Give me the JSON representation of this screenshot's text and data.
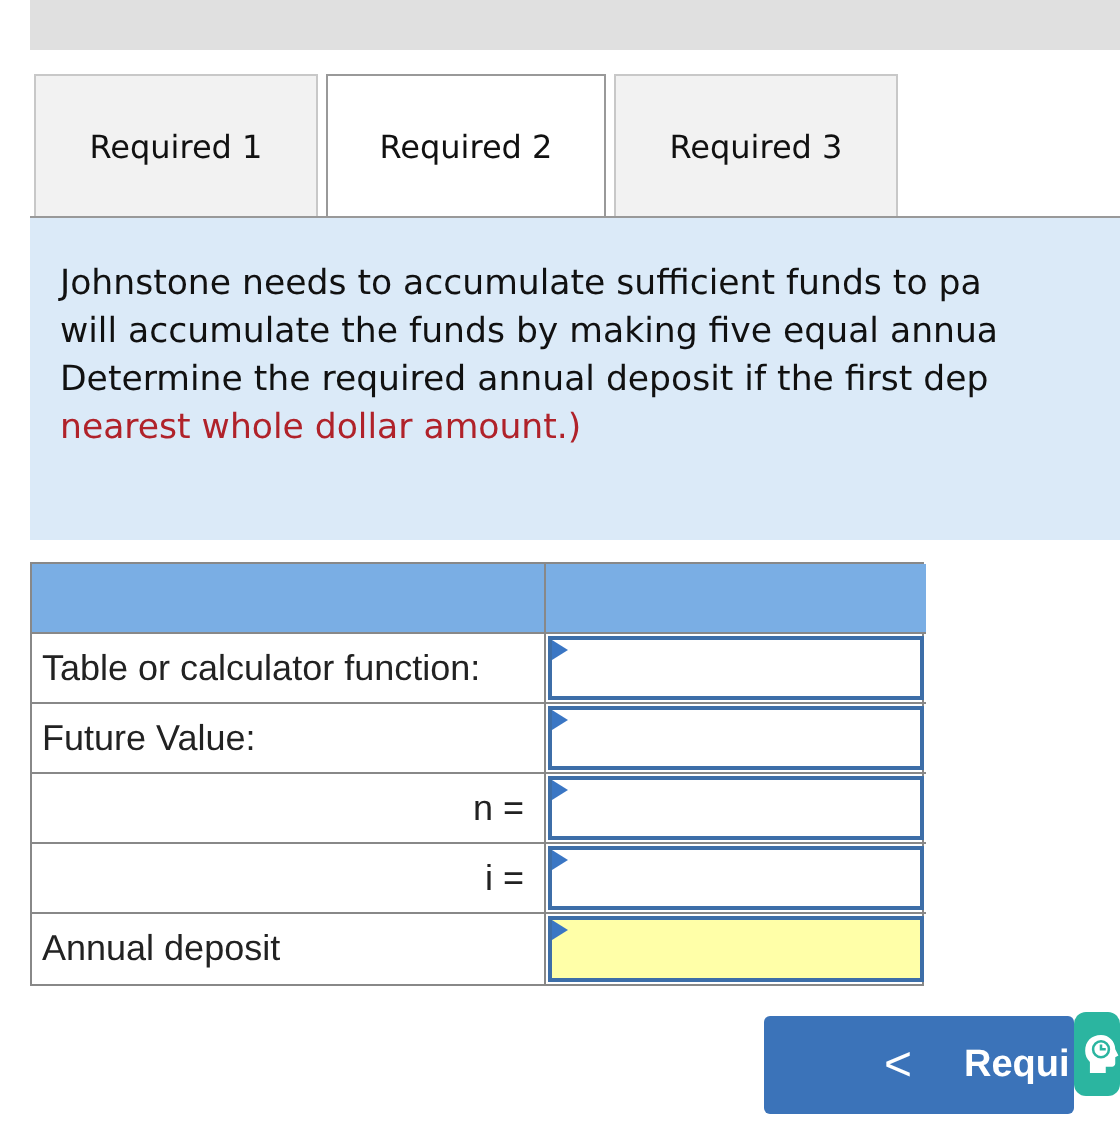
{
  "tabs": [
    {
      "label": "Required 1",
      "selected": false
    },
    {
      "label": "Required 2",
      "selected": true
    },
    {
      "label": "Required 3",
      "selected": false
    }
  ],
  "question": {
    "lines": [
      {
        "text": "Johnstone needs to accumulate sufficient funds to pa",
        "kind": "plain"
      },
      {
        "text": "will accumulate the funds by making five equal annua",
        "kind": "plain"
      },
      {
        "text": "Determine the required annual deposit if the first dep",
        "kind": "plain"
      },
      {
        "text": "nearest whole dollar amount.)",
        "kind": "instruction"
      }
    ]
  },
  "table": {
    "rows": [
      {
        "label": "Table or calculator function:",
        "kind": "label",
        "highlighted": false
      },
      {
        "label": "Future Value:",
        "kind": "label",
        "highlighted": false
      },
      {
        "label": "n =",
        "kind": "variable",
        "highlighted": false
      },
      {
        "label": "i =",
        "kind": "variable",
        "highlighted": false
      },
      {
        "label": "Annual deposit",
        "kind": "label",
        "highlighted": true
      }
    ]
  },
  "nav_button": {
    "chevron": "<",
    "label": "Requi"
  }
}
